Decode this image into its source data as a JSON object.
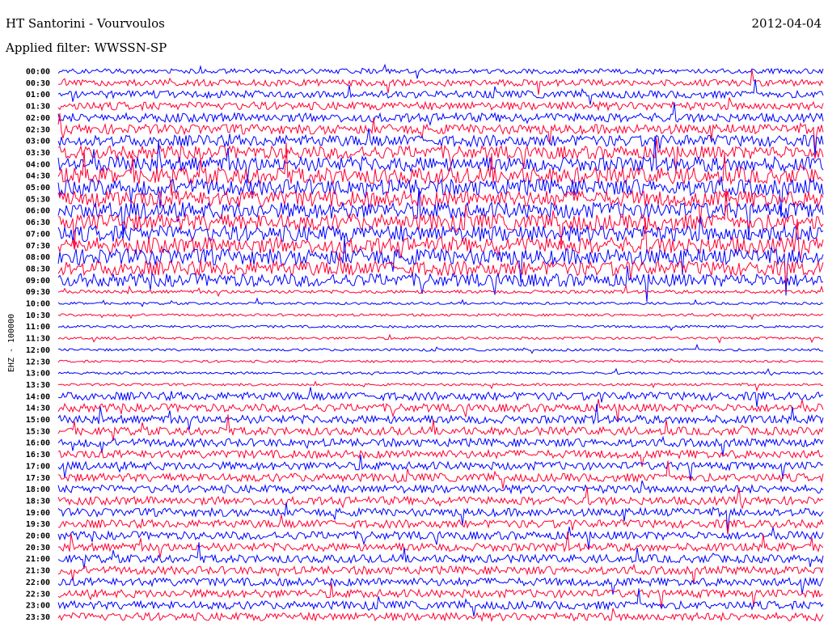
{
  "header": {
    "station": "HT Santorini - Vourvoulos",
    "filter": "Applied filter: WWSSN-SP",
    "date": "2012-04-04"
  },
  "chart_data": {
    "type": "helicorder",
    "channel_label": "EHZ - 100000",
    "colors": [
      "#ff0033",
      "#0000ff"
    ],
    "rows": [
      {
        "time": "00:00",
        "color": "#0000ff",
        "level": 0.6
      },
      {
        "time": "00:30",
        "color": "#ff0033",
        "level": 0.8
      },
      {
        "time": "01:00",
        "color": "#0000ff",
        "level": 0.9
      },
      {
        "time": "01:30",
        "color": "#ff0033",
        "level": 1.0
      },
      {
        "time": "02:00",
        "color": "#0000ff",
        "level": 1.1
      },
      {
        "time": "02:30",
        "color": "#ff0033",
        "level": 1.2
      },
      {
        "time": "03:00",
        "color": "#0000ff",
        "level": 1.4
      },
      {
        "time": "03:30",
        "color": "#ff0033",
        "level": 1.6
      },
      {
        "time": "04:00",
        "color": "#0000ff",
        "level": 1.8
      },
      {
        "time": "04:30",
        "color": "#ff0033",
        "level": 2.0
      },
      {
        "time": "05:00",
        "color": "#0000ff",
        "level": 2.0
      },
      {
        "time": "05:30",
        "color": "#ff0033",
        "level": 2.0
      },
      {
        "time": "06:00",
        "color": "#0000ff",
        "level": 2.0
      },
      {
        "time": "06:30",
        "color": "#ff0033",
        "level": 2.0
      },
      {
        "time": "07:00",
        "color": "#0000ff",
        "level": 2.0
      },
      {
        "time": "07:30",
        "color": "#ff0033",
        "level": 2.0
      },
      {
        "time": "08:00",
        "color": "#0000ff",
        "level": 2.0
      },
      {
        "time": "08:30",
        "color": "#ff0033",
        "level": 1.8
      },
      {
        "time": "09:00",
        "color": "#0000ff",
        "level": 1.6
      },
      {
        "time": "09:30",
        "color": "#ff0033",
        "level": 0.4
      },
      {
        "time": "10:00",
        "color": "#0000ff",
        "level": 0.3
      },
      {
        "time": "10:30",
        "color": "#ff0033",
        "level": 0.3
      },
      {
        "time": "11:00",
        "color": "#0000ff",
        "level": 0.3
      },
      {
        "time": "11:30",
        "color": "#ff0033",
        "level": 0.3
      },
      {
        "time": "12:00",
        "color": "#0000ff",
        "level": 0.3
      },
      {
        "time": "12:30",
        "color": "#ff0033",
        "level": 0.3
      },
      {
        "time": "13:00",
        "color": "#0000ff",
        "level": 0.3
      },
      {
        "time": "13:30",
        "color": "#ff0033",
        "level": 0.3
      },
      {
        "time": "14:00",
        "color": "#0000ff",
        "level": 1.0
      },
      {
        "time": "14:30",
        "color": "#ff0033",
        "level": 1.0
      },
      {
        "time": "15:00",
        "color": "#0000ff",
        "level": 1.0
      },
      {
        "time": "15:30",
        "color": "#ff0033",
        "level": 1.0
      },
      {
        "time": "16:00",
        "color": "#0000ff",
        "level": 1.0
      },
      {
        "time": "16:30",
        "color": "#ff0033",
        "level": 1.0
      },
      {
        "time": "17:00",
        "color": "#0000ff",
        "level": 1.0
      },
      {
        "time": "17:30",
        "color": "#ff0033",
        "level": 1.0
      },
      {
        "time": "18:00",
        "color": "#0000ff",
        "level": 1.0
      },
      {
        "time": "18:30",
        "color": "#ff0033",
        "level": 1.0
      },
      {
        "time": "19:00",
        "color": "#0000ff",
        "level": 1.0
      },
      {
        "time": "19:30",
        "color": "#ff0033",
        "level": 1.0
      },
      {
        "time": "20:00",
        "color": "#0000ff",
        "level": 1.0
      },
      {
        "time": "20:30",
        "color": "#ff0033",
        "level": 1.0
      },
      {
        "time": "21:00",
        "color": "#0000ff",
        "level": 1.0
      },
      {
        "time": "21:30",
        "color": "#ff0033",
        "level": 1.0
      },
      {
        "time": "22:00",
        "color": "#0000ff",
        "level": 1.0
      },
      {
        "time": "22:30",
        "color": "#ff0033",
        "level": 1.0
      },
      {
        "time": "23:00",
        "color": "#0000ff",
        "level": 1.0
      },
      {
        "time": "23:30",
        "color": "#ff0033",
        "level": 1.0
      }
    ]
  }
}
